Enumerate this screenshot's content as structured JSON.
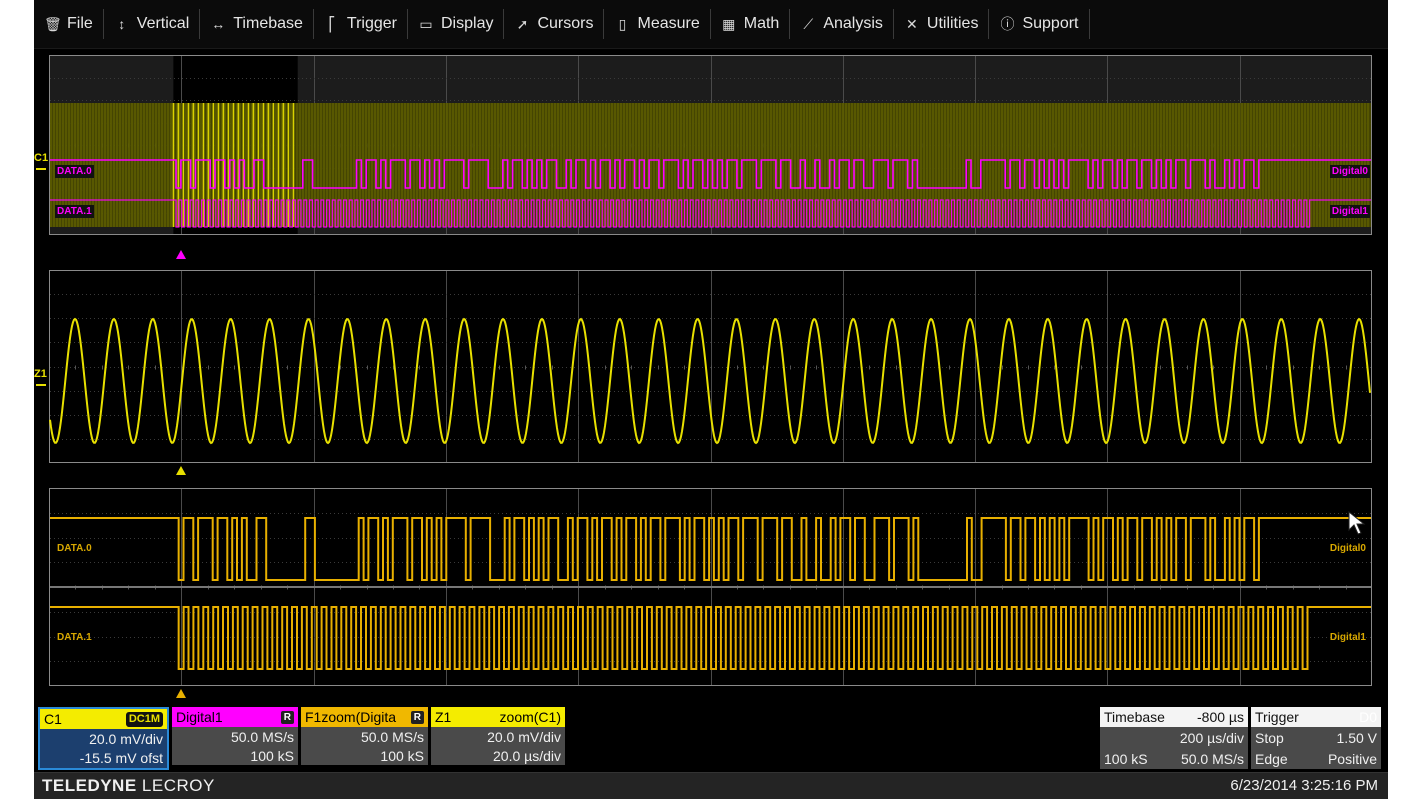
{
  "menu": [
    {
      "label": "File",
      "icon": "trash-can-icon",
      "glyph": "🗑"
    },
    {
      "label": "Vertical",
      "icon": "vertical-arrows-icon",
      "glyph": "↕"
    },
    {
      "label": "Timebase",
      "icon": "horizontal-arrows-icon",
      "glyph": "↔"
    },
    {
      "label": "Trigger",
      "icon": "trigger-flag-icon",
      "glyph": "⎡"
    },
    {
      "label": "Display",
      "icon": "display-icon",
      "glyph": "▭"
    },
    {
      "label": "Cursors",
      "icon": "cursor-arrow-icon",
      "glyph": "➚"
    },
    {
      "label": "Measure",
      "icon": "measure-icon",
      "glyph": "▯"
    },
    {
      "label": "Math",
      "icon": "calculator-icon",
      "glyph": "▦"
    },
    {
      "label": "Analysis",
      "icon": "chart-icon",
      "glyph": "⟋"
    },
    {
      "label": "Utilities",
      "icon": "tools-icon",
      "glyph": "✕"
    },
    {
      "label": "Support",
      "icon": "info-icon",
      "glyph": "ⓘ"
    }
  ],
  "grids": {
    "top": {
      "channel_marker": "C1",
      "labels": {
        "data0_left": "DATA.0",
        "data1_left": "DATA.1",
        "data0_right": "Digital0",
        "data1_right": "Digital1"
      },
      "zoom_region_fraction": [
        0.094,
        0.188
      ],
      "trigger_fraction": 0.1
    },
    "middle": {
      "channel_marker": "Z1",
      "cycles": 34,
      "trigger_fraction": 0.1
    },
    "bottom": {
      "labels": {
        "data0_left": "DATA.0",
        "data1_left": "DATA.1",
        "data0_right": "Digital0",
        "data1_right": "Digital1"
      },
      "trigger_fraction": 0.1
    }
  },
  "signals": {
    "data0_bits": "1111101101110110101001100000000110000000001011010111011010101111011110001011010101100101101011010110101101110101101010110111011101100100100101101100111011101000000000010011111011011010101011110101101011011010101101110100101011011111111111",
    "data1_bits_note": "clock-like toggling between trigger and end"
  },
  "colors": {
    "c1_yellow": "#e8e000",
    "digital_magenta": "#ff00ff",
    "zoom_orange": "#e8b000",
    "c1_desc_blue": "#1c3f6e",
    "grid": "#5a5a5a"
  },
  "descriptors": [
    {
      "id": "C1",
      "head_left": "C1",
      "head_right": "DC1M",
      "row1": "20.0 mV/div",
      "row2": "-15.5 mV ofst"
    },
    {
      "id": "Digital1",
      "head_left": "Digital1",
      "head_right": "R",
      "row1": "50.0 MS/s",
      "row2": "100 kS"
    },
    {
      "id": "F1",
      "head_left": "F1zoom(Digita",
      "head_right": "R",
      "row1": "50.0 MS/s",
      "row2": "100 kS"
    },
    {
      "id": "Z1",
      "head_left": "Z1",
      "head_right": "zoom(C1)",
      "row1": "20.0 mV/div",
      "row2": "20.0 µs/div"
    }
  ],
  "timebase": {
    "label": "Timebase",
    "delay": "-800 µs",
    "scale": "200 µs/div",
    "samples": "100 kS",
    "rate": "50.0 MS/s"
  },
  "trigger": {
    "label": "Trigger",
    "source": "D0",
    "mode": "Stop",
    "level": "1.50 V",
    "type": "Edge",
    "slope": "Positive"
  },
  "status": {
    "brand_bold": "TELEDYNE",
    "brand_light": " LECROY",
    "datetime": "6/23/2014 3:25:16 PM"
  }
}
